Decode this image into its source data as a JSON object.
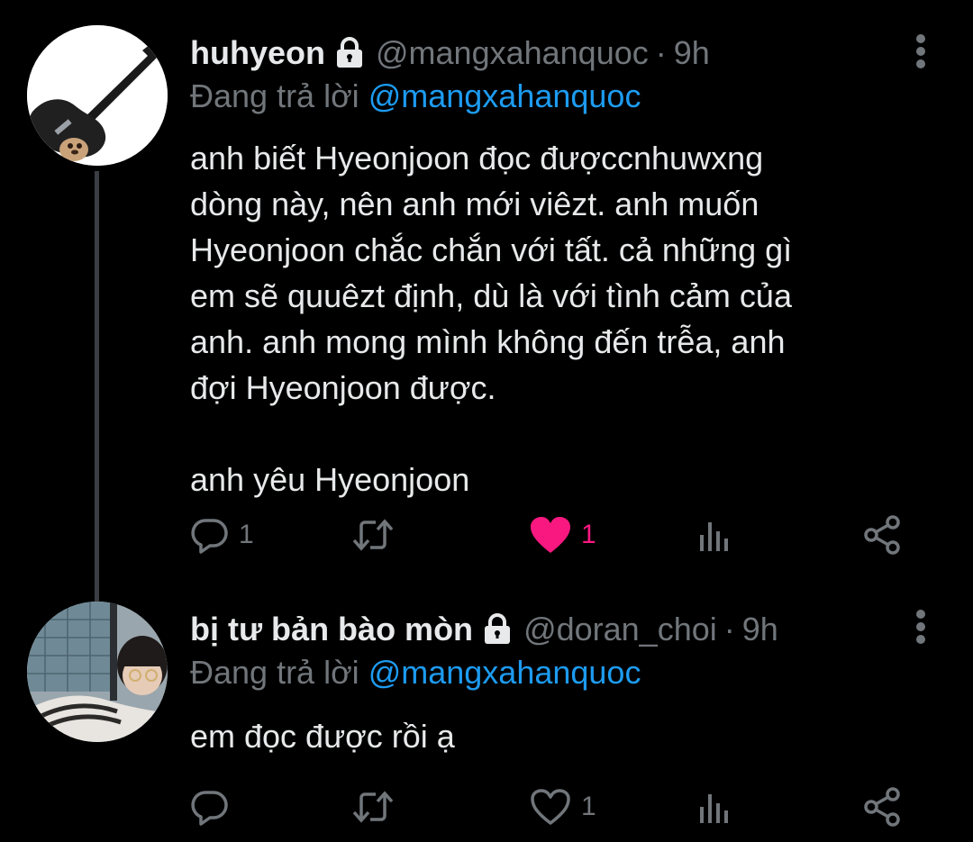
{
  "tweets": [
    {
      "display_name": "huhyeon",
      "handle": "@mangxahanquoc",
      "separator": "·",
      "time": "9h",
      "replying_prefix": "Đang trả lời",
      "replying_to": "@mangxahanquoc",
      "text": "anh biết Hyeonjoon đọc đượccnhuwxng\ndòng này, nên anh mới viêzt. anh muốn\nHyeonjoon chắc chắn với tất. cả những gì\nem sẽ quuêzt định, dù là với tình cảm của\nanh. anh mong mình không đến trễa, anh\nđợi Hyeonjoon được.\n\nanh yêu Hyeonjoon",
      "reply_count": "1",
      "retweet_count": "",
      "like_count": "1",
      "liked": true,
      "icons": [
        "lock-icon",
        "more-icon",
        "reply-icon",
        "retweet-icon",
        "heart-filled-icon",
        "views-icon",
        "share-icon"
      ]
    },
    {
      "display_name": "bị tư bản bào mòn",
      "handle": "@doran_choi",
      "separator": "·",
      "time": "9h",
      "replying_prefix": "Đang trả lời",
      "replying_to": "@mangxahanquoc",
      "text": "em đọc được rồi ạ",
      "reply_count": "",
      "retweet_count": "",
      "like_count": "1",
      "liked": false,
      "icons": [
        "lock-icon",
        "more-icon",
        "reply-icon",
        "retweet-icon",
        "heart-outline-icon",
        "views-icon",
        "share-icon"
      ]
    }
  ],
  "colors": {
    "background": "#000000",
    "primary_text": "#e7e9ea",
    "secondary_text": "#71767b",
    "link": "#1d9bf0",
    "like": "#f91880",
    "thread_line": "#3a3d41"
  }
}
